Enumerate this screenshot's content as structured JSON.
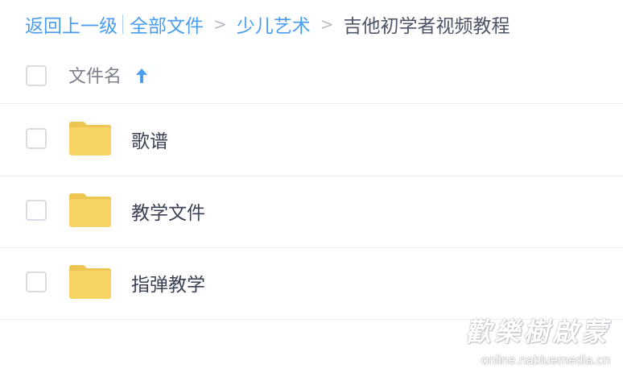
{
  "breadcrumb": {
    "back": "返回上一级",
    "all_files": "全部文件",
    "sep": ">",
    "level1": "少儿艺术",
    "current": "吉他初学者视频教程"
  },
  "header": {
    "column_name": "文件名"
  },
  "files": [
    {
      "name": "歌谱",
      "icon": "folder-icon"
    },
    {
      "name": "教学文件",
      "icon": "folder-icon"
    },
    {
      "name": "指弹教学",
      "icon": "folder-icon"
    }
  ],
  "watermark": {
    "logo": "歡樂樹啟蒙",
    "url": "online.nabluemedia.cn"
  },
  "colors": {
    "link": "#4b9df0",
    "folder": "#f6d465",
    "folder_tab": "#efc85a",
    "text": "#3b4254",
    "divider": "#eef0f3"
  }
}
